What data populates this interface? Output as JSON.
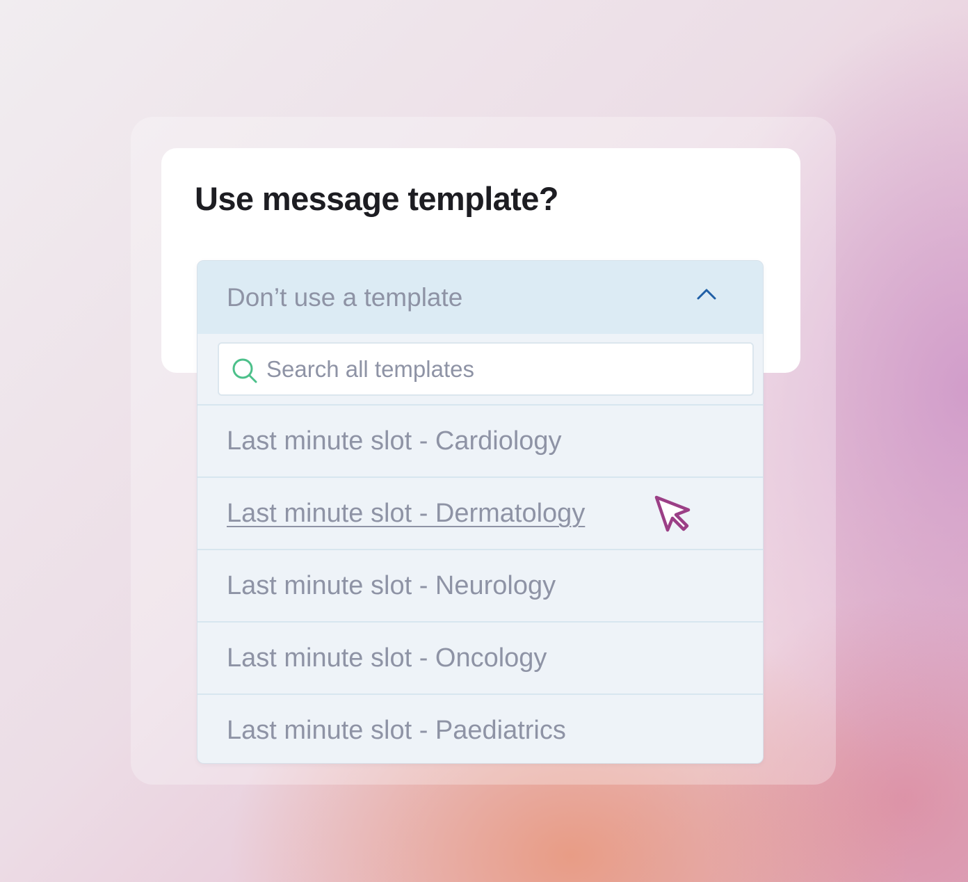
{
  "dialog": {
    "title": "Use message template?"
  },
  "dropdown": {
    "selected_value": "Don’t use a template",
    "expanded": true,
    "toggle_icon": "chevron-up-icon",
    "search": {
      "placeholder": "Search all templates",
      "value": "",
      "icon": "search-icon"
    },
    "options": [
      {
        "label": "Last minute slot - Cardiology",
        "hovered": false
      },
      {
        "label": "Last minute slot - Dermatology",
        "hovered": true
      },
      {
        "label": "Last minute slot - Neurology",
        "hovered": false
      },
      {
        "label": "Last minute slot - Oncology",
        "hovered": false
      },
      {
        "label": "Last minute slot - Paediatrics",
        "hovered": false
      }
    ]
  },
  "pointer": {
    "icon": "mouse-pointer-icon"
  },
  "colors": {
    "title_text": "#1d1d22",
    "muted_text": "#8e93a5",
    "trigger_background": "#dcebf4",
    "list_background": "#eef3f8",
    "chevron": "#1f5fa6",
    "search_icon": "#4cc08a",
    "cursor": "#9b3f86"
  }
}
